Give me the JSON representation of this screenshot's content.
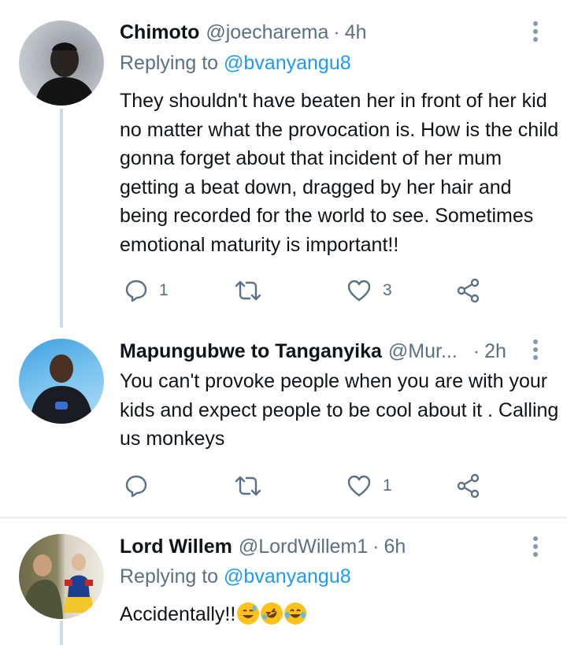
{
  "tweets": [
    {
      "name": "Chimoto",
      "handle": "@joecharema",
      "separator": "·",
      "time": "4h",
      "replying_prefix": "Replying to",
      "replying_to": "@bvanyangu8",
      "text": "They shouldn't have beaten her in front of her kid no matter what the provocation is. How is the child gonna forget about that incident of her mum getting a beat down, dragged by her hair and being recorded for the world to see. Sometimes emotional maturity is important!!",
      "replies": "1",
      "retweets": "",
      "likes": "3",
      "icons": [
        "reply-icon",
        "retweet-icon",
        "like-icon",
        "share-icon",
        "more-options-icon"
      ]
    },
    {
      "name": "Mapungubwe to Tanganyika",
      "handle": "@Mur...",
      "separator": "·",
      "time": "2h",
      "text": "You can't provoke people when you are with your kids and expect people to be cool about it . Calling us monkeys",
      "replies": "",
      "retweets": "",
      "likes": "1",
      "icons": [
        "reply-icon",
        "retweet-icon",
        "like-icon",
        "share-icon",
        "more-options-icon"
      ]
    },
    {
      "name": "Lord Willem",
      "handle": "@LordWillem1",
      "separator": "·",
      "time": "6h",
      "replying_prefix": "Replying to",
      "replying_to": "@bvanyangu8",
      "text": "Accidentally!!",
      "emojis": [
        "grinning-sweat-emoji",
        "rolling-laughing-emoji",
        "tears-of-joy-emoji"
      ]
    }
  ],
  "colors": {
    "text": "#0f1419",
    "secondary": "#5b7083",
    "accent": "#1d9bf0",
    "divider": "#e6ecf0",
    "thread_line": "#cfd9de"
  }
}
